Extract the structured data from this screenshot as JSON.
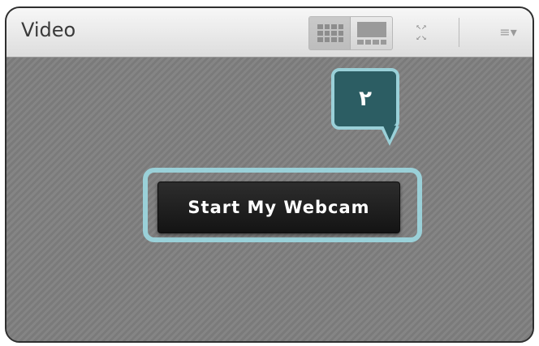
{
  "pod": {
    "title": "Video"
  },
  "toolbar": {
    "layout_buttons": [
      {
        "name": "grid-layout",
        "icon": "grid-icon",
        "active": true
      },
      {
        "name": "filmstrip-layout",
        "icon": "filmstrip-icon",
        "active": false
      }
    ],
    "fullscreen_icon": "fullscreen-icon",
    "menu_icon": "pod-menu-icon",
    "menu_glyph": "≡▾"
  },
  "stage": {
    "start_button_label": "Start My Webcam"
  },
  "annotation": {
    "step_number": "٢"
  },
  "colors": {
    "callout_fill": "#2c5d63",
    "callout_border": "#9ad0d8",
    "button_bg": "#1e1e1e",
    "stage_bg": "#7d7d7d"
  }
}
